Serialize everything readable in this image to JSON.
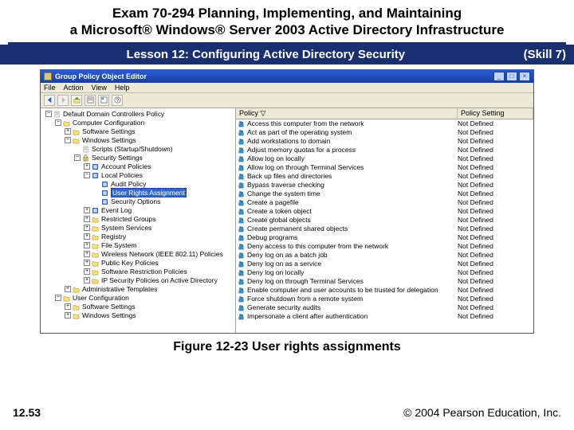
{
  "slide": {
    "title_l1": "Exam 70-294 Planning, Implementing, and Maintaining",
    "title_l2": "a Microsoft® Windows® Server 2003 Active Directory Infrastructure",
    "lesson": "Lesson 12: Configuring Active Directory Security",
    "skill": "(Skill 7)",
    "figure_caption": "Figure 12-23 User rights assignments",
    "page": "12.53",
    "copyright": "© 2004 Pearson Education, Inc."
  },
  "window": {
    "title": "Group Policy Object Editor",
    "menus": [
      "File",
      "Action",
      "View",
      "Help"
    ],
    "list_header": {
      "policy": "Policy  ▽",
      "setting": "Policy Setting"
    },
    "not_defined": "Not Defined",
    "tree": [
      {
        "d": 1,
        "tw": "-",
        "ic": "scroll",
        "t": "Default Domain Controllers Policy"
      },
      {
        "d": 2,
        "tw": "-",
        "ic": "folder",
        "t": "Computer Configuration"
      },
      {
        "d": 3,
        "tw": "+",
        "ic": "folder",
        "t": "Software Settings"
      },
      {
        "d": 3,
        "tw": "-",
        "ic": "folder",
        "t": "Windows Settings"
      },
      {
        "d": 4,
        "tw": " ",
        "ic": "scroll",
        "t": "Scripts (Startup/Shutdown)"
      },
      {
        "d": 4,
        "tw": "-",
        "ic": "lock",
        "t": "Security Settings"
      },
      {
        "d": 5,
        "tw": "+",
        "ic": "book",
        "t": "Account Policies"
      },
      {
        "d": 5,
        "tw": "-",
        "ic": "book",
        "t": "Local Policies"
      },
      {
        "d": 6,
        "tw": " ",
        "ic": "book",
        "t": "Audit Policy"
      },
      {
        "d": 6,
        "tw": " ",
        "ic": "book",
        "t": "User Rights Assignment",
        "sel": true
      },
      {
        "d": 6,
        "tw": " ",
        "ic": "book",
        "t": "Security Options"
      },
      {
        "d": 5,
        "tw": "+",
        "ic": "book",
        "t": "Event Log"
      },
      {
        "d": 5,
        "tw": "+",
        "ic": "folder",
        "t": "Restricted Groups"
      },
      {
        "d": 5,
        "tw": "+",
        "ic": "folder",
        "t": "System Services"
      },
      {
        "d": 5,
        "tw": "+",
        "ic": "folder",
        "t": "Registry"
      },
      {
        "d": 5,
        "tw": "+",
        "ic": "folder",
        "t": "File System"
      },
      {
        "d": 5,
        "tw": "+",
        "ic": "folder",
        "t": "Wireless Network (IEEE 802.11) Policies"
      },
      {
        "d": 5,
        "tw": "+",
        "ic": "folder",
        "t": "Public Key Policies"
      },
      {
        "d": 5,
        "tw": "+",
        "ic": "folder",
        "t": "Software Restriction Policies"
      },
      {
        "d": 5,
        "tw": "+",
        "ic": "folder",
        "t": "IP Security Policies on Active Directory"
      },
      {
        "d": 3,
        "tw": "+",
        "ic": "folder",
        "t": "Administrative Templates"
      },
      {
        "d": 2,
        "tw": "-",
        "ic": "folder",
        "t": "User Configuration"
      },
      {
        "d": 3,
        "tw": "+",
        "ic": "folder",
        "t": "Software Settings"
      },
      {
        "d": 3,
        "tw": "+",
        "ic": "folder",
        "t": "Windows Settings"
      }
    ],
    "policies": [
      "Access this computer from the network",
      "Act as part of the operating system",
      "Add workstations to domain",
      "Adjust memory quotas for a process",
      "Allow log on locally",
      "Allow log on through Terminal Services",
      "Back up files and directories",
      "Bypass traverse checking",
      "Change the system time",
      "Create a pagefile",
      "Create a token object",
      "Create global objects",
      "Create permanent shared objects",
      "Debug programs",
      "Deny access to this computer from the network",
      "Deny log on as a batch job",
      "Deny log on as a service",
      "Deny log on locally",
      "Deny log on through Terminal Services",
      "Enable computer and user accounts to be trusted for delegation",
      "Force shutdown from a remote system",
      "Generate security audits",
      "Impersonate a client after authentication"
    ]
  }
}
